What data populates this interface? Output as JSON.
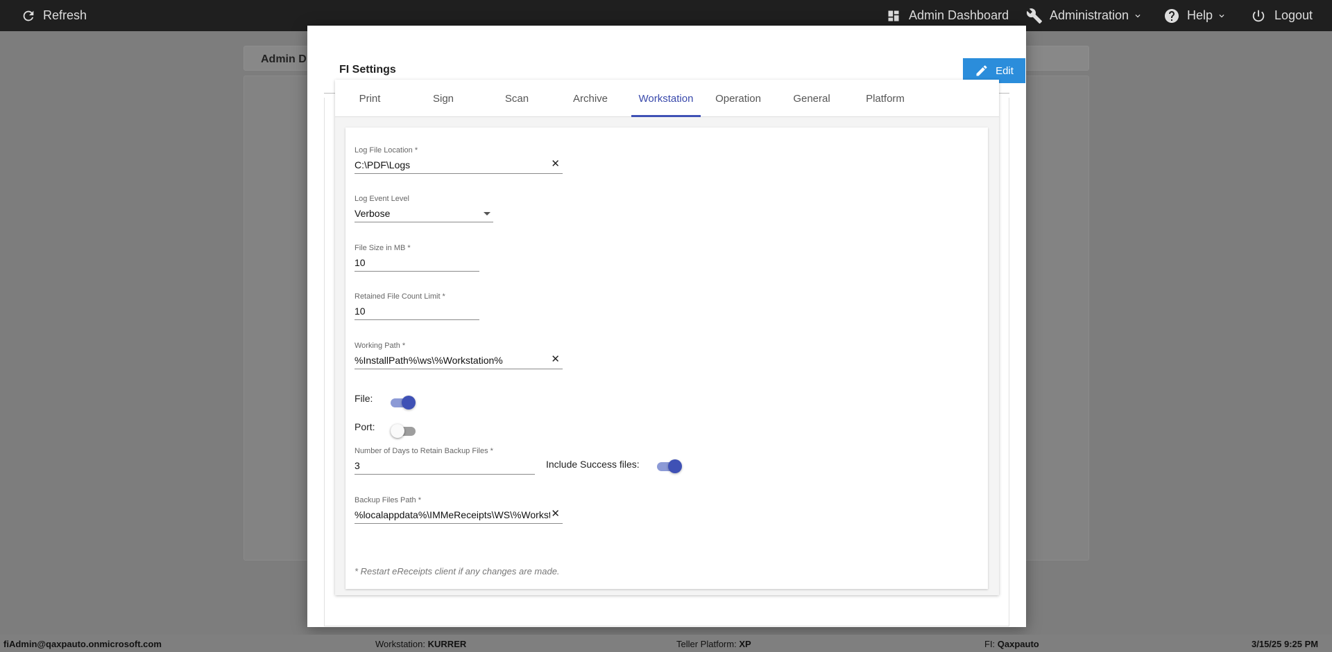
{
  "topbar": {
    "refresh_label": "Refresh",
    "admin_dashboard_label": "Admin Dashboard",
    "administration_label": "Administration",
    "help_label": "Help",
    "logout_label": "Logout"
  },
  "background": {
    "card_title": "Admin D"
  },
  "modal": {
    "title": "FI Settings",
    "edit_label": "Edit",
    "tabs": [
      {
        "label": "Print"
      },
      {
        "label": "Sign"
      },
      {
        "label": "Scan"
      },
      {
        "label": "Archive"
      },
      {
        "label": "Workstation"
      },
      {
        "label": "Operation"
      },
      {
        "label": "General"
      },
      {
        "label": "Platform"
      }
    ],
    "active_tab": "Workstation",
    "accent_color": "#3f51b5",
    "edit_color": "#2b8ddb"
  },
  "form": {
    "log_file_location": {
      "label": "Log File Location *",
      "value": "C:\\PDF\\Logs"
    },
    "log_event_level": {
      "label": "Log Event Level",
      "value": "Verbose"
    },
    "file_size": {
      "label": "File Size in MB *",
      "value": "10"
    },
    "retained_file_count": {
      "label": "Retained File Count Limit *",
      "value": "10"
    },
    "working_path": {
      "label": "Working Path *",
      "value": "%InstallPath%\\ws\\%Workstation%"
    },
    "file_toggle": {
      "label": "File:",
      "on": true
    },
    "port_toggle": {
      "label": "Port:",
      "on": false
    },
    "backup_days": {
      "label": "Number of Days to Retain Backup Files *",
      "value": "3"
    },
    "include_success": {
      "label": "Include Success files:",
      "on": true
    },
    "backup_path": {
      "label": "Backup Files Path *",
      "value": "%localappdata%\\IMMeReceipts\\WS\\%Workstation%"
    },
    "note": "* Restart eReceipts client if any changes are made."
  },
  "statusbar": {
    "user": "fiAdmin@qaxpauto.onmicrosoft.com",
    "workstation_label": "Workstation:",
    "workstation_value": "KURRER",
    "teller_label": "Teller Platform:",
    "teller_value": "XP",
    "fi_label": "FI:",
    "fi_value": "Qaxpauto",
    "datetime": "3/15/25 9:25 PM"
  }
}
